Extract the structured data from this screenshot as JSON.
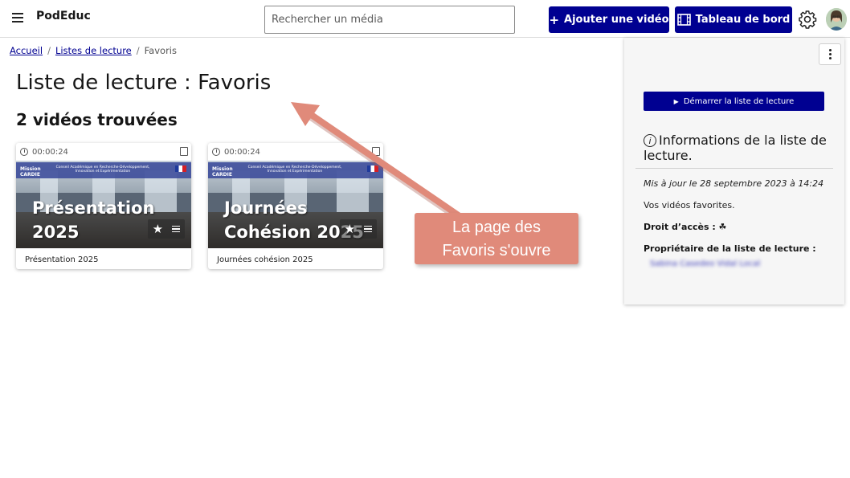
{
  "header": {
    "brand": "PodEduc",
    "search_placeholder": "Rechercher un média",
    "add_video_label": "Ajouter une vidéo",
    "dashboard_label": "Tableau de bord"
  },
  "breadcrumb": {
    "home": "Accueil",
    "playlists": "Listes de lecture",
    "current": "Favoris"
  },
  "main": {
    "title": "Liste de lecture : Favoris",
    "count": "2 vidéos trouvées",
    "videos": [
      {
        "duration": "00:00:24",
        "thumb_line1": "Présentation",
        "thumb_line2": "2025",
        "caption": "Présentation 2025"
      },
      {
        "duration": "00:00:24",
        "thumb_line1": "Journées",
        "thumb_line2": "Cohésion 2025",
        "caption": "Journées cohésion 2025"
      }
    ],
    "thumb_mission": "Mission CARDIE",
    "thumb_subline": "Conseil Académique en Recherche-Développement, Innovation et Expérimentation"
  },
  "callout": {
    "line1": "La page des",
    "line2": "Favoris s'ouvre"
  },
  "side": {
    "start_label": "Démarrer la liste de lecture",
    "info_title": "Informations de la liste de lecture.",
    "updated": "Mis à jour le 28 septembre 2023 à 14:24",
    "description": "Vos vidéos favorites.",
    "access": "Droit d’accès : ☘",
    "owner_label": "Propriétaire de la liste de lecture :",
    "owner_name": "Sabina Casedeo Vidal Local"
  },
  "colors": {
    "primary": "#000091",
    "callout": "#e08a7a",
    "arrow": "#e08a7a"
  }
}
